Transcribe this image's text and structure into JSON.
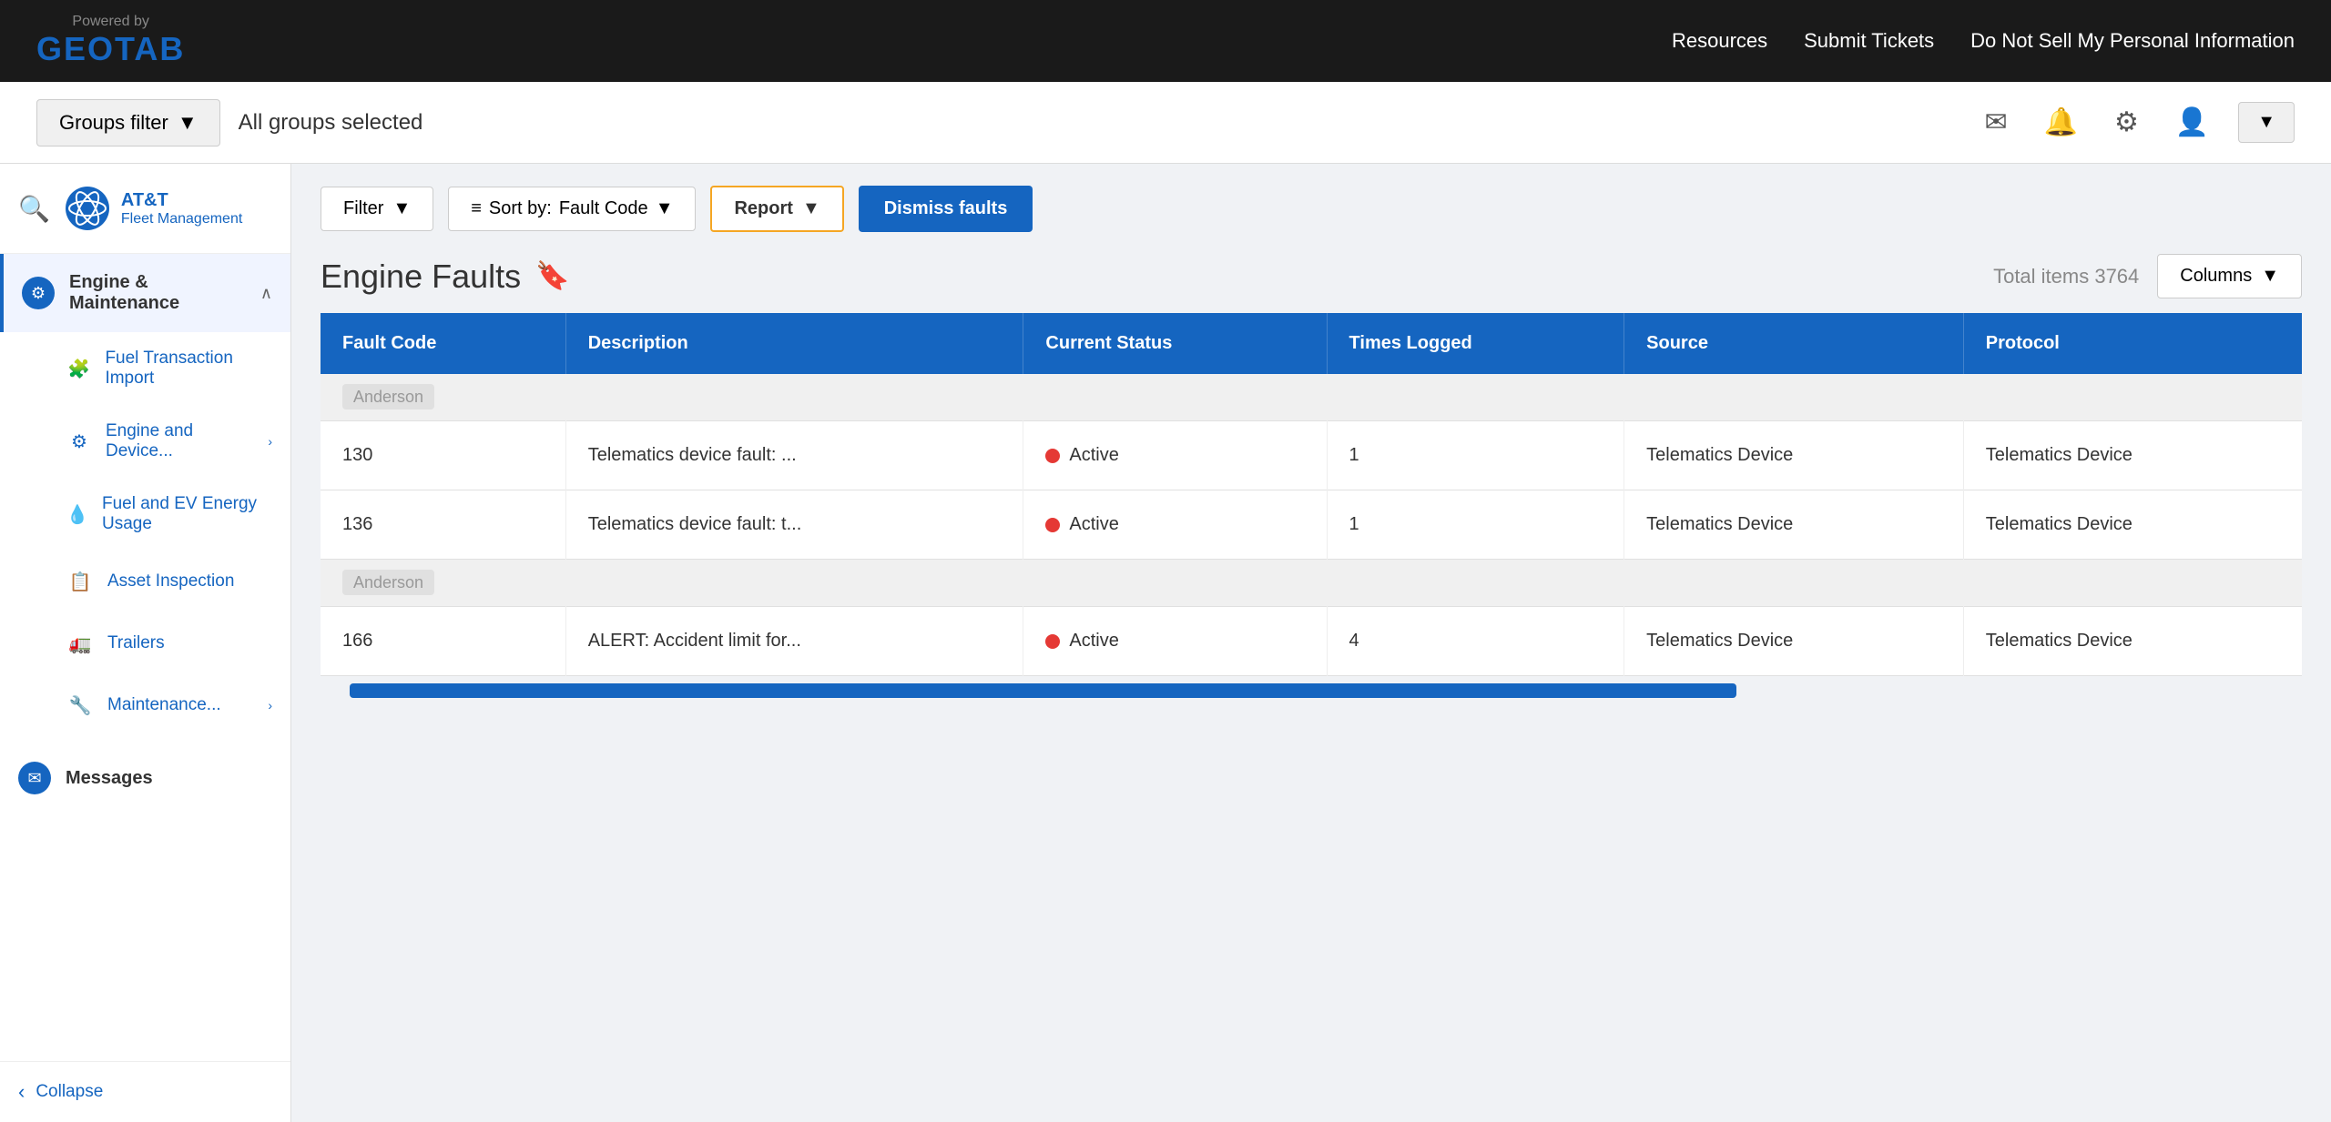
{
  "topNav": {
    "poweredBy": "Powered by",
    "brand": "GEOTAB",
    "links": [
      "Resources",
      "Submit Tickets",
      "Do Not Sell My Personal Information"
    ]
  },
  "groupsBar": {
    "filterLabel": "Groups filter",
    "filterValue": "All groups selected",
    "icons": [
      "mail",
      "bell",
      "gear",
      "user"
    ]
  },
  "sidebar": {
    "searchPlaceholder": "Search",
    "brandName": "AT&T",
    "brandSub": "Fleet Management",
    "sections": [
      {
        "id": "engine-maintenance",
        "label": "Engine & Maintenance",
        "active": true,
        "hasChevron": true,
        "icon": "⚙"
      }
    ],
    "subItems": [
      {
        "id": "fuel-transaction",
        "label": "Fuel Transaction Import",
        "icon": "🧩"
      },
      {
        "id": "engine-device",
        "label": "Engine and Device...",
        "icon": "⚙",
        "hasChevron": true
      },
      {
        "id": "fuel-ev",
        "label": "Fuel and EV Energy Usage",
        "icon": "💧"
      },
      {
        "id": "asset-inspection",
        "label": "Asset Inspection",
        "icon": "📋"
      },
      {
        "id": "trailers",
        "label": "Trailers",
        "icon": "🚛"
      },
      {
        "id": "maintenance",
        "label": "Maintenance...",
        "icon": "🔧",
        "hasChevron": true
      }
    ],
    "otherSections": [
      {
        "id": "messages",
        "label": "Messages",
        "icon": "✉"
      }
    ],
    "collapse": "Collapse"
  },
  "toolbar": {
    "filterLabel": "Filter",
    "sortLabel": "Sort by:",
    "sortValue": "Fault Code",
    "reportLabel": "Report",
    "dismissLabel": "Dismiss faults"
  },
  "pageTitle": {
    "title": "Engine Faults",
    "totalLabel": "Total items 3764",
    "columnsLabel": "Columns"
  },
  "table": {
    "columns": [
      {
        "id": "fault-code",
        "label": "Fault Code"
      },
      {
        "id": "description",
        "label": "Description"
      },
      {
        "id": "current-status",
        "label": "Current Status"
      },
      {
        "id": "times-logged",
        "label": "Times Logged"
      },
      {
        "id": "source",
        "label": "Source"
      },
      {
        "id": "protocol",
        "label": "Protocol"
      }
    ],
    "rows": [
      {
        "type": "group",
        "name": "Anderson",
        "blurred": true
      },
      {
        "type": "data",
        "faultCode": "130",
        "description": "Telematics device fault: ...",
        "status": "Active",
        "timesLogged": "1",
        "source": "Telematics Device",
        "protocol": "Telematics Device"
      },
      {
        "type": "data",
        "faultCode": "136",
        "description": "Telematics device fault: t...",
        "status": "Active",
        "timesLogged": "1",
        "source": "Telematics Device",
        "protocol": "Telematics Device"
      },
      {
        "type": "group",
        "name": "Anderson",
        "blurred": false
      },
      {
        "type": "data",
        "faultCode": "166",
        "description": "ALERT: Accident limit for...",
        "status": "Active",
        "timesLogged": "4",
        "source": "Telematics Device",
        "protocol": "Telematics Device"
      }
    ]
  }
}
